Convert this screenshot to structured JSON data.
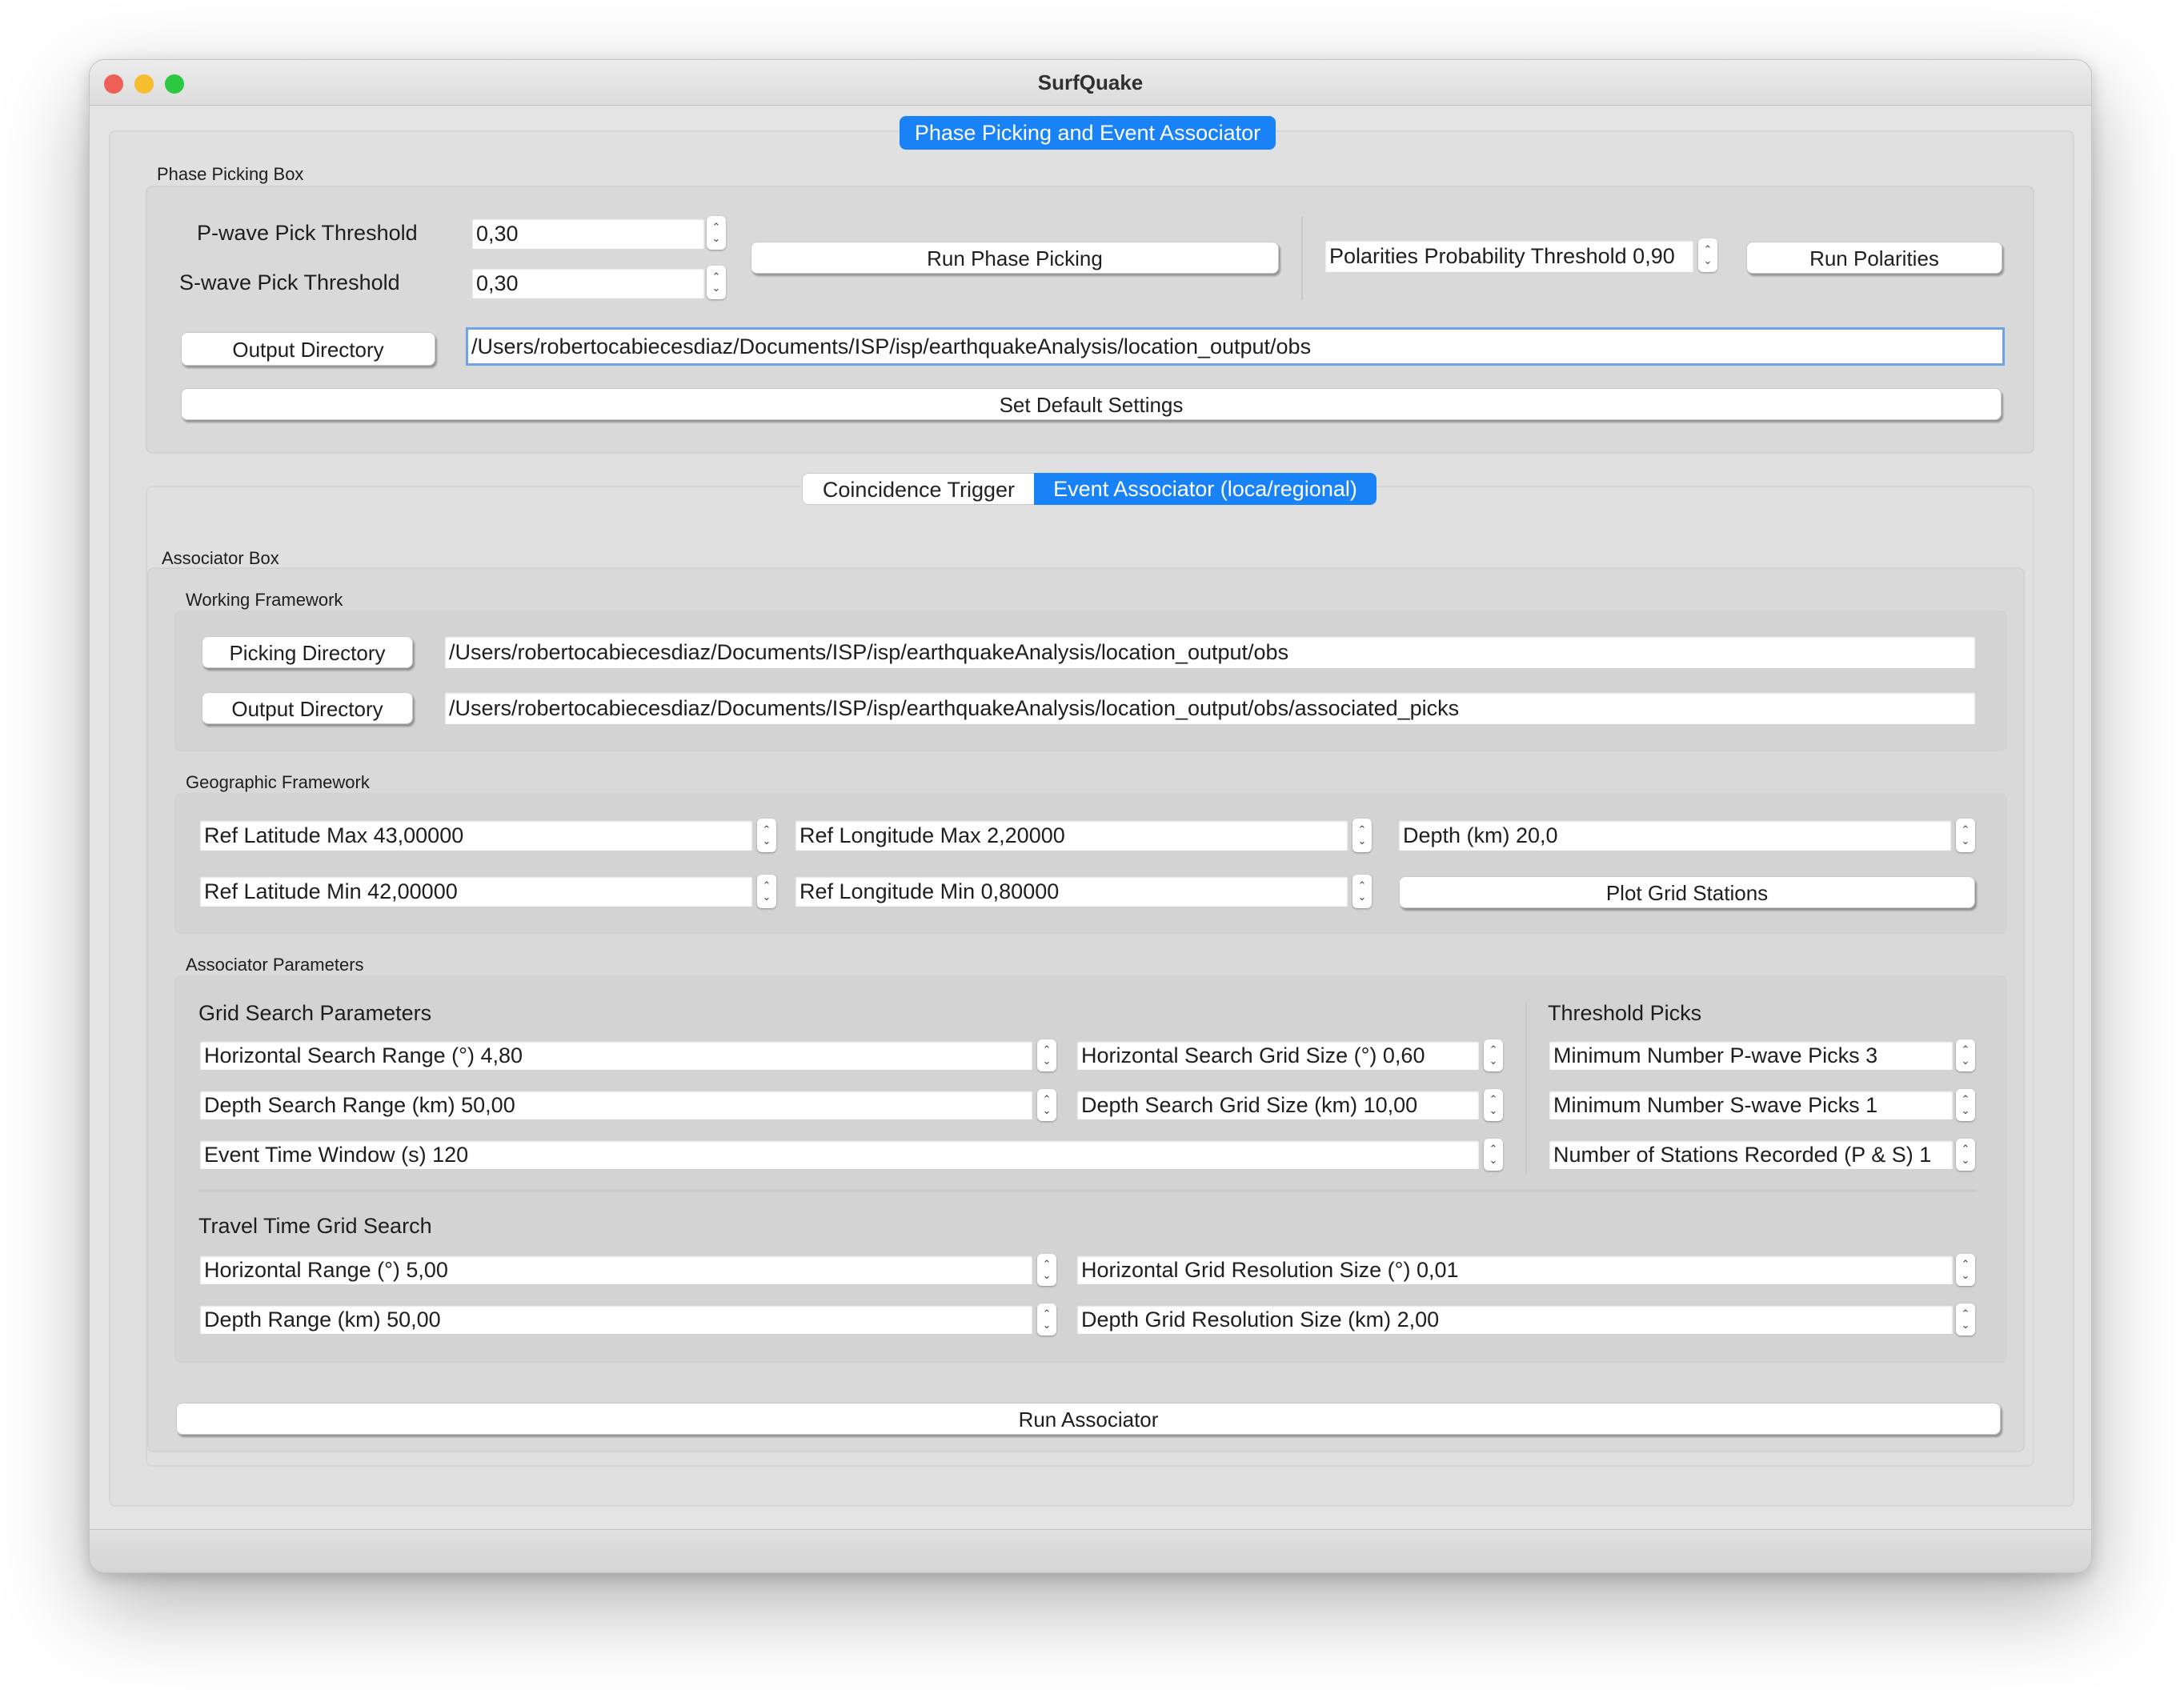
{
  "window": {
    "title": "SurfQuake",
    "main_tab": "Phase Picking and Event Associator",
    "traffic_colors": {
      "close": "#ee5f57",
      "minimize": "#f5bd2f",
      "zoom": "#2bc840"
    }
  },
  "phase_picking": {
    "group_title": "Phase Picking Box",
    "p_label": "P-wave Pick Threshold",
    "p_value": "0,30",
    "s_label": "S-wave Pick Threshold",
    "s_value": "0,30",
    "run_phase_button": "Run Phase Picking",
    "polarities_field": "Polarities Probability Threshold 0,90",
    "run_polarities_button": "Run Polarities",
    "output_dir_button": "Output Directory",
    "output_dir_value": "/Users/robertocabiecesdiaz/Documents/ISP/isp/earthquakeAnalysis/location_output/obs",
    "default_settings_button": "Set Default Settings"
  },
  "sub_tabs": [
    "Coincidence Trigger",
    "Event Associator (loca/regional)"
  ],
  "associator": {
    "box_title": "Associator Box",
    "working": {
      "title": "Working Framework",
      "picking_dir_button": "Picking Directory",
      "picking_dir_value": "/Users/robertocabiecesdiaz/Documents/ISP/isp/earthquakeAnalysis/location_output/obs",
      "output_dir_button": "Output Directory",
      "output_dir_value": "/Users/robertocabiecesdiaz/Documents/ISP/isp/earthquakeAnalysis/location_output/obs/associated_picks"
    },
    "geographic": {
      "title": "Geographic Framework",
      "lat_max": "Ref Latitude Max 43,00000",
      "lon_max": "Ref Longitude Max 2,20000",
      "depth": "Depth (km) 20,0",
      "lat_min": "Ref Latitude Min 42,00000",
      "lon_min": "Ref Longitude Min  0,80000",
      "plot_button": "Plot Grid Stations"
    },
    "parameters": {
      "title": "Associator Parameters",
      "grid_title": "Grid Search Parameters",
      "h_range": "Horizontal Search Range (°) 4,80",
      "h_grid": "Horizontal Search Grid Size (°) 0,60",
      "d_range": "Depth Search Range (km) 50,00",
      "d_grid": "Depth Search Grid Size (km) 10,00",
      "time_window": "Event Time Window (s) 120",
      "threshold_title": "Threshold Picks",
      "min_p": "Minimum Number P-wave Picks 3",
      "min_s": "Minimum Number S-wave Picks 1",
      "stations": "Number of Stations Recorded (P & S) 1",
      "tt_title": "Travel Time Grid Search",
      "tt_h_range": "Horizontal Range (°) 5,00",
      "tt_h_res": "Horizontal Grid Resolution Size (°) 0,01",
      "tt_d_range": "Depth Range (km) 50,00",
      "tt_d_res": "Depth Grid Resolution Size (km) 2,00"
    },
    "run_button": "Run Associator"
  }
}
